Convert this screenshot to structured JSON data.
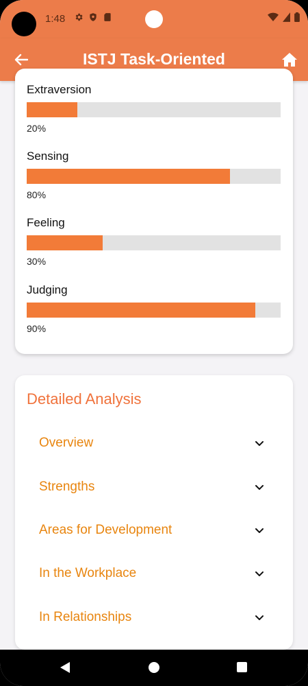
{
  "status_bar": {
    "time": "1:48"
  },
  "app_bar": {
    "title": "ISTJ Task-Oriented"
  },
  "traits": [
    {
      "label": "Extraversion",
      "percent_text": "20%",
      "value": 20
    },
    {
      "label": "Sensing",
      "percent_text": "80%",
      "value": 80
    },
    {
      "label": "Feeling",
      "percent_text": "30%",
      "value": 30
    },
    {
      "label": "Judging",
      "percent_text": "90%",
      "value": 90
    }
  ],
  "analysis": {
    "title": "Detailed Analysis",
    "items": [
      {
        "label": "Overview"
      },
      {
        "label": "Strengths"
      },
      {
        "label": "Areas for Development"
      },
      {
        "label": "In the Workplace"
      },
      {
        "label": "In Relationships"
      }
    ]
  },
  "colors": {
    "header": "#ec7c4a",
    "bar_fill": "#f27b38",
    "bar_track": "#e2e2e2",
    "section_title": "#f0723b",
    "accordion_label": "#e8850f"
  },
  "icons": {
    "back": "arrow-left-icon",
    "home": "home-icon",
    "chevron": "chevron-down-icon"
  }
}
